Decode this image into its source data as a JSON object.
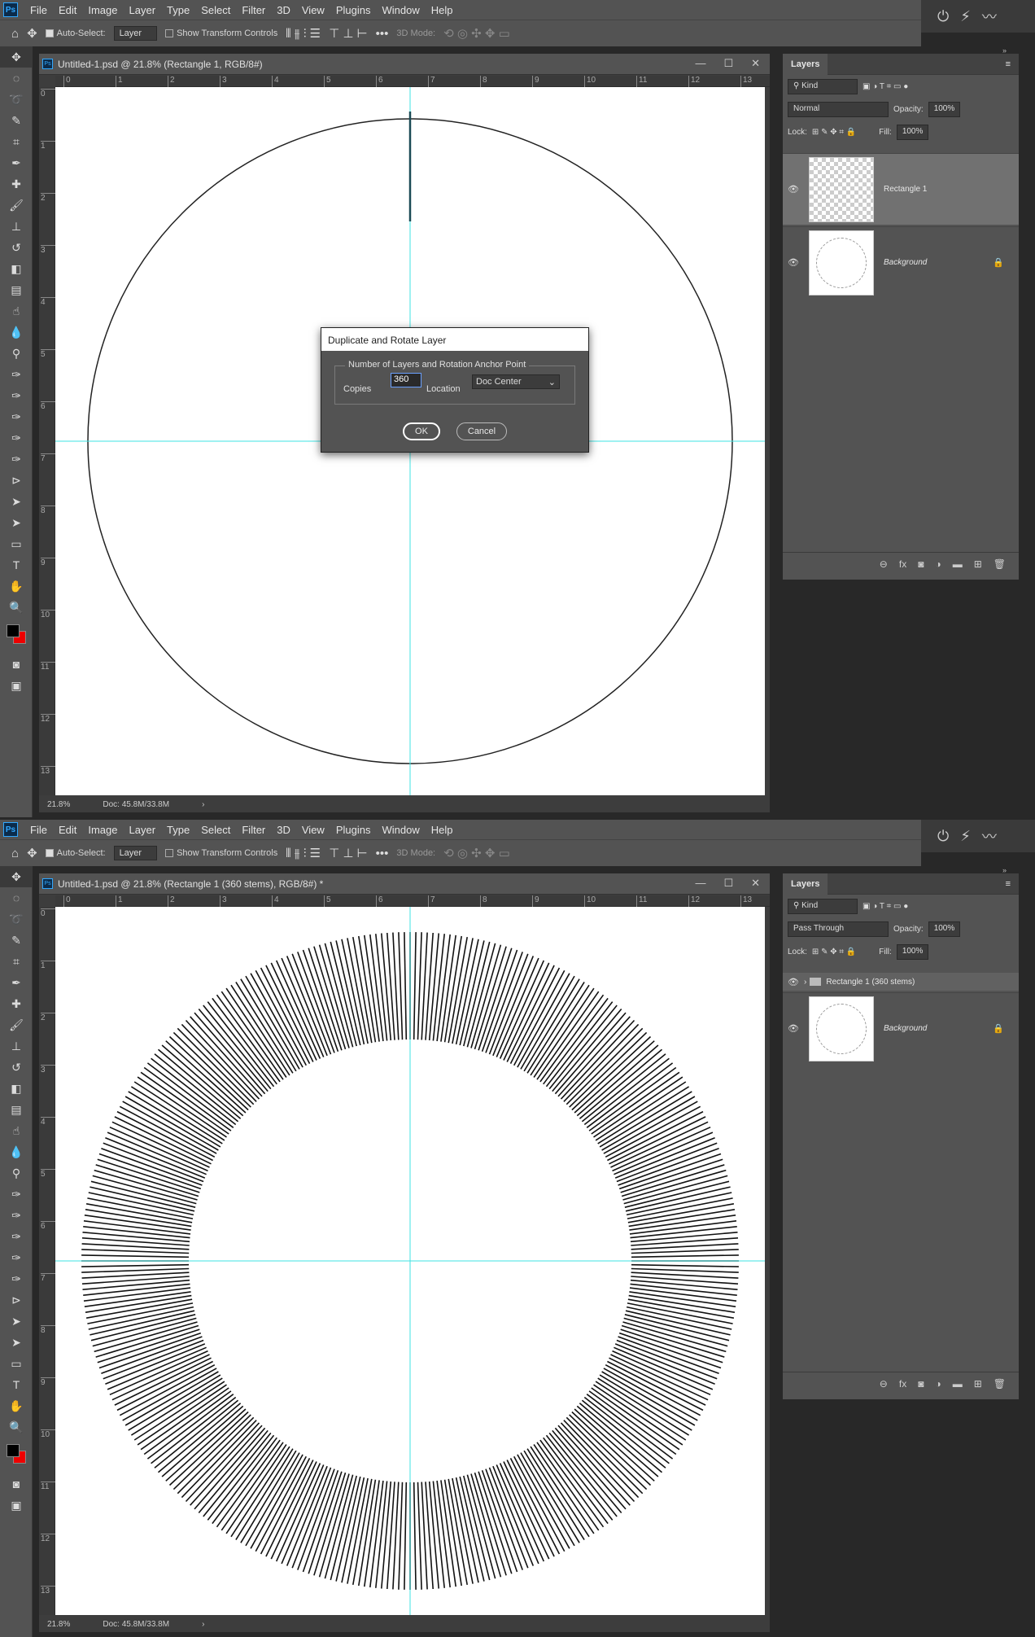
{
  "menu": {
    "items": [
      "File",
      "Edit",
      "Image",
      "Layer",
      "Type",
      "Select",
      "Filter",
      "3D",
      "View",
      "Plugins",
      "Window",
      "Help"
    ]
  },
  "options_bar": {
    "auto_select_label": "Auto-Select:",
    "auto_select_value": "Layer",
    "transform_label": "Show Transform Controls",
    "mode_3d_label": "3D Mode:"
  },
  "screen1": {
    "doc_title": "Untitled-1.psd @ 21.8% (Rectangle 1, RGB/8#)",
    "zoom": "21.8%",
    "doc_size": "Doc: 45.8M/33.8M",
    "dialog": {
      "title": "Duplicate and Rotate Layer",
      "group_label": "Number of Layers and Rotation Anchor Point",
      "copies_label": "Copies",
      "copies_value": "360",
      "location_label": "Location",
      "location_value": "Doc Center",
      "ok_label": "OK",
      "cancel_label": "Cancel"
    },
    "layers_panel": {
      "tab": "Layers",
      "filter_kind": "Kind",
      "blend_mode": "Normal",
      "opacity_label": "Opacity:",
      "opacity_value": "100%",
      "lock_label": "Lock:",
      "fill_label": "Fill:",
      "fill_value": "100%",
      "layers": [
        {
          "name": "Rectangle 1",
          "selected": true
        },
        {
          "name": "Background",
          "locked": true
        }
      ]
    }
  },
  "screen2": {
    "doc_title": "Untitled-1.psd @ 21.8% (Rectangle 1 (360 stems), RGB/8#) *",
    "zoom": "21.8%",
    "doc_size": "Doc: 45.8M/33.8M",
    "layers_panel": {
      "tab": "Layers",
      "filter_kind": "Kind",
      "blend_mode": "Pass Through",
      "opacity_label": "Opacity:",
      "opacity_value": "100%",
      "lock_label": "Lock:",
      "fill_label": "Fill:",
      "fill_value": "100%",
      "layers": [
        {
          "name": "Rectangle 1 (360 stems)",
          "type": "group"
        },
        {
          "name": "Background",
          "locked": true
        }
      ]
    }
  },
  "rulers": {
    "h_ticks": [
      "0",
      "1",
      "2",
      "3",
      "4",
      "5",
      "6",
      "7",
      "8",
      "9",
      "10",
      "11",
      "12",
      "13"
    ],
    "v_ticks": [
      "0",
      "1",
      "2",
      "3",
      "4",
      "5",
      "6",
      "7",
      "8",
      "9",
      "10",
      "11",
      "12",
      "13"
    ]
  },
  "colors": {
    "guide": "#3fe3e3",
    "panel": "#535353",
    "background": "#282828",
    "accent": "#31a8ff"
  },
  "stems": {
    "count": 360
  }
}
